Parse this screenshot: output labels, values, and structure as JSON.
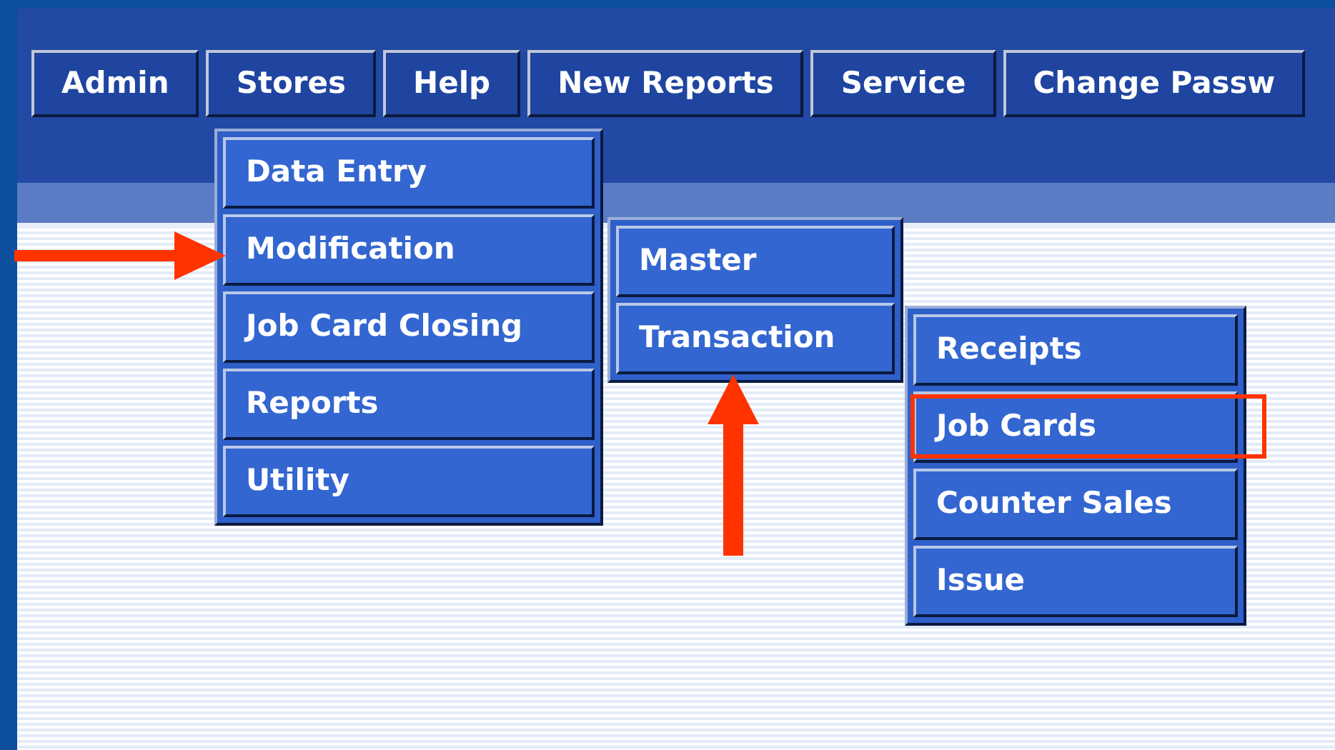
{
  "menu_bar": [
    {
      "label": "Admin"
    },
    {
      "label": "Stores"
    },
    {
      "label": "Help"
    },
    {
      "label": "New Reports"
    },
    {
      "label": "Service"
    },
    {
      "label": "Change Passw"
    }
  ],
  "menus": [
    {
      "items": [
        {
          "label": "Data Entry"
        },
        {
          "label": "Modification",
          "pointed": true
        },
        {
          "label": "Job Card Closing"
        },
        {
          "label": "Reports"
        },
        {
          "label": "Utility"
        }
      ]
    },
    {
      "items": [
        {
          "label": "Master"
        },
        {
          "label": "Transaction",
          "pointed": true
        }
      ]
    },
    {
      "items": [
        {
          "label": "Receipts",
          "highlighted": false
        },
        {
          "label": "Job Cards",
          "highlighted": true
        },
        {
          "label": "Counter Sales",
          "highlighted": false
        },
        {
          "label": "Issue",
          "highlighted": false
        }
      ]
    }
  ]
}
